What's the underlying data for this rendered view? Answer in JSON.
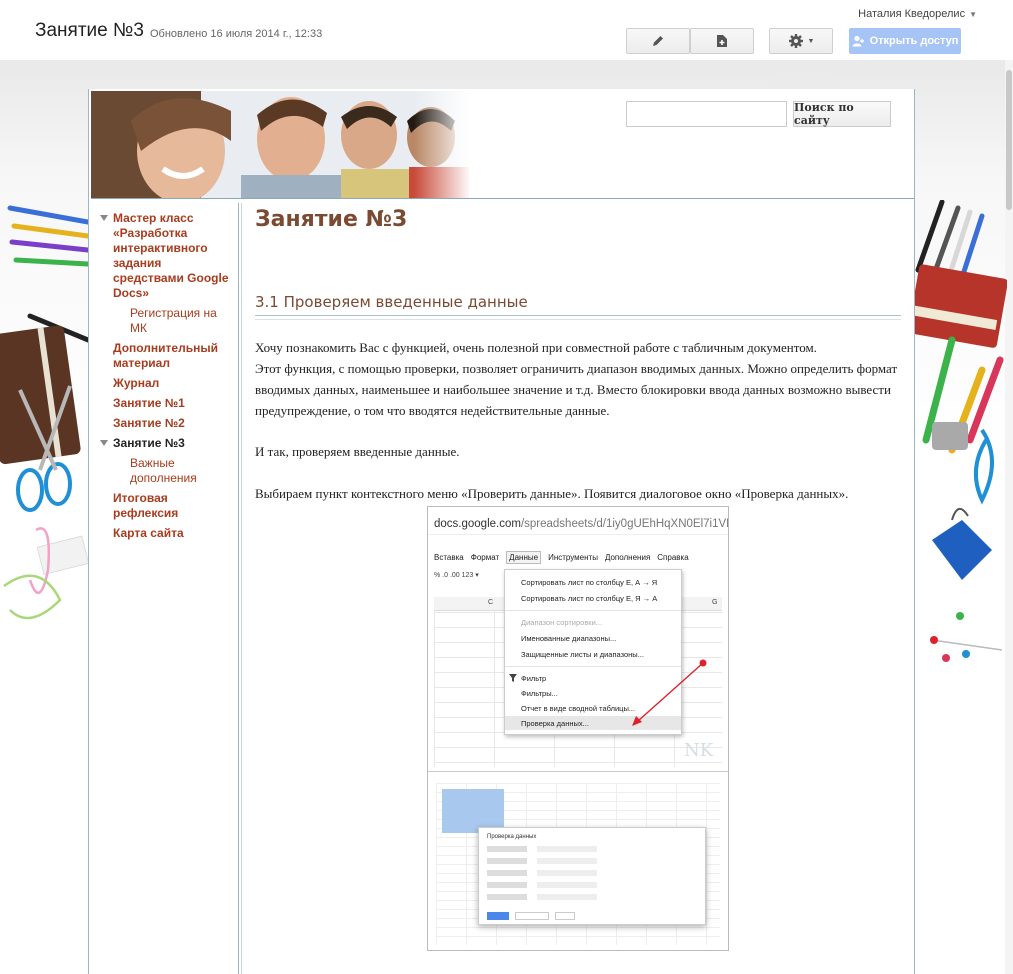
{
  "topbar": {
    "page_name": "Занятие №3",
    "updated": "Обновлено 16 июля 2014 г., 12:33",
    "user_name": "Наталия Кведорелис",
    "share_label": "Открыть доступ",
    "icons": [
      "pencil-icon",
      "new-page-icon",
      "gear-icon",
      "person-icon"
    ]
  },
  "search": {
    "placeholder": "",
    "button_label": "Поиск по сайту"
  },
  "nav": {
    "items": [
      {
        "label": "Мастер класс «Разработка интерактивного задания средствами Google Docs»",
        "level": 0,
        "expanded": true
      },
      {
        "label": "Регистрация на МК",
        "level": 1
      },
      {
        "label": "Дополнительный материал",
        "level": 0
      },
      {
        "label": "Журнал",
        "level": 0
      },
      {
        "label": "Занятие №1",
        "level": 0
      },
      {
        "label": "Занятие №2",
        "level": 0
      },
      {
        "label": "Занятие №3",
        "level": 0,
        "expanded": true,
        "current": true
      },
      {
        "label": "Важные дополнения",
        "level": 1
      },
      {
        "label": "Итоговая рефлексия",
        "level": 0
      },
      {
        "label": "Карта сайта",
        "level": 0
      }
    ]
  },
  "content": {
    "title": "Занятие №3",
    "section_title": "3.1 Проверяем введенные данные",
    "paragraph1_line1": "Хочу познакомить Вас с функцией, очень полезной при совместной работе с табличным документом.",
    "paragraph1_line2": "Этот функция, с помощью проверки, позволяет ограничить диапазон вводимых данных. Можно определить формат вводимых данных, наименьшее и наибольшее значение и т.д. Вместо блокировки ввода данных возможно вывести предупреждение, о том что вводятся недействительные данные.",
    "paragraph2": "И так, проверяем введенные данные.",
    "paragraph3": "Выбираем пункт контекстного меню «Проверить данные». Появится диалоговое окно «Проверка данных»."
  },
  "figure": {
    "url_main": "docs.google.com",
    "url_rest": "/spreadsheets/d/1iy0gUEhHqXN0El7i1VNCLojl",
    "menubar": [
      "Вставка",
      "Формат",
      "Данные",
      "Инструменты",
      "Дополнения",
      "Справка"
    ],
    "toolbar": "%   .0   .00   123 ▾",
    "columns": [
      "C",
      "G"
    ],
    "menu_items": [
      {
        "label": "Сортировать лист по столбцу E, А → Я",
        "enabled": true
      },
      {
        "label": "Сортировать лист по столбцу E, Я → А",
        "enabled": true
      },
      {
        "label": "Диапазон сортировки...",
        "enabled": false
      },
      {
        "label": "Именованные диапазоны...",
        "enabled": true
      },
      {
        "label": "Защищенные листы и диапазоны...",
        "enabled": true
      },
      {
        "label": "Фильтр",
        "enabled": true
      },
      {
        "label": "Фильтры...",
        "enabled": true
      },
      {
        "label": "Отчет в виде сводной таблицы...",
        "enabled": true
      },
      {
        "label": "Проверка данных...",
        "enabled": true,
        "highlighted": true
      }
    ],
    "dialog_title": "Проверка данных",
    "arrow_color": "#e0202a"
  },
  "colors": {
    "link": "#a83c1f",
    "heading": "#7b4a33",
    "frame_border": "#9bb6c4",
    "share_button": "#a6c4f6"
  }
}
